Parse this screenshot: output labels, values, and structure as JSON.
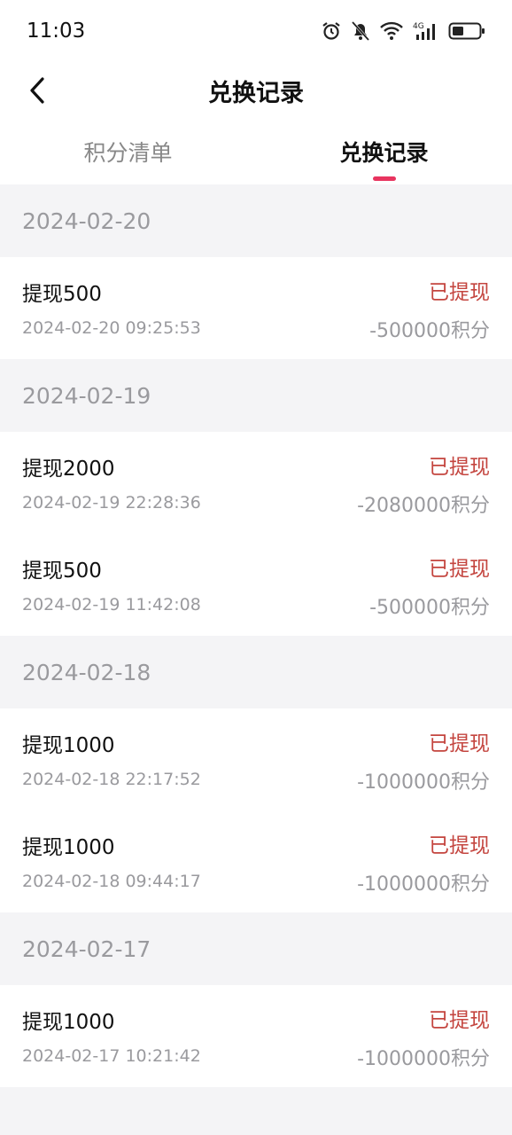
{
  "status_bar": {
    "time": "11:03",
    "icons": [
      "alarm-icon",
      "bell-off-icon",
      "wifi-icon",
      "signal-4g-icon",
      "battery-icon"
    ]
  },
  "nav": {
    "title": "兑换记录",
    "back_icon": "chevron-left-icon"
  },
  "tabs": [
    {
      "label": "积分清单",
      "active": false
    },
    {
      "label": "兑换记录",
      "active": true
    }
  ],
  "accent_color": "#e8345f",
  "status_color": "#c4453f",
  "groups": [
    {
      "date": "2024-02-20",
      "records": [
        {
          "title": "提现500",
          "time": "2024-02-20  09:25:53",
          "status": "已提现",
          "points": "-500000积分"
        }
      ]
    },
    {
      "date": "2024-02-19",
      "records": [
        {
          "title": "提现2000",
          "time": "2024-02-19  22:28:36",
          "status": "已提现",
          "points": "-2080000积分"
        },
        {
          "title": "提现500",
          "time": "2024-02-19  11:42:08",
          "status": "已提现",
          "points": "-500000积分"
        }
      ]
    },
    {
      "date": "2024-02-18",
      "records": [
        {
          "title": "提现1000",
          "time": "2024-02-18  22:17:52",
          "status": "已提现",
          "points": "-1000000积分"
        },
        {
          "title": "提现1000",
          "time": "2024-02-18  09:44:17",
          "status": "已提现",
          "points": "-1000000积分"
        }
      ]
    },
    {
      "date": "2024-02-17",
      "records": [
        {
          "title": "提现1000",
          "time": "2024-02-17  10:21:42",
          "status": "已提现",
          "points": "-1000000积分"
        }
      ]
    }
  ]
}
